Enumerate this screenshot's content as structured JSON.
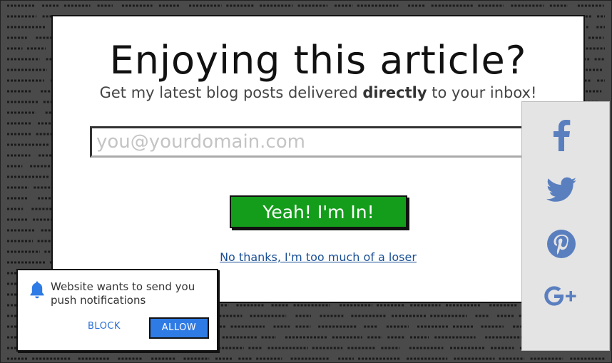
{
  "popup": {
    "title": "Enjoying this article?",
    "subtitle_prefix": "Get my latest blog posts delivered ",
    "subtitle_bold": "directly",
    "subtitle_suffix": " to your inbox!",
    "email_placeholder": "you@yourdomain.com",
    "cta_label": "Yeah! I'm In!",
    "decline_link": "No thanks, I'm too much of a loser"
  },
  "social": {
    "icons": [
      "facebook-icon",
      "twitter-icon",
      "pinterest-icon",
      "google-plus-icon"
    ]
  },
  "notification": {
    "message": "Website wants to send you push notifications",
    "block_label": "BLOCK",
    "allow_label": "ALLOW",
    "icon": "bell-icon"
  },
  "colors": {
    "background": "#4a4a4a",
    "cta_green": "#149d1b",
    "link_blue": "#1a4f94",
    "social_icon_blue": "#5a7fbf",
    "allow_blue": "#2f7be6"
  }
}
